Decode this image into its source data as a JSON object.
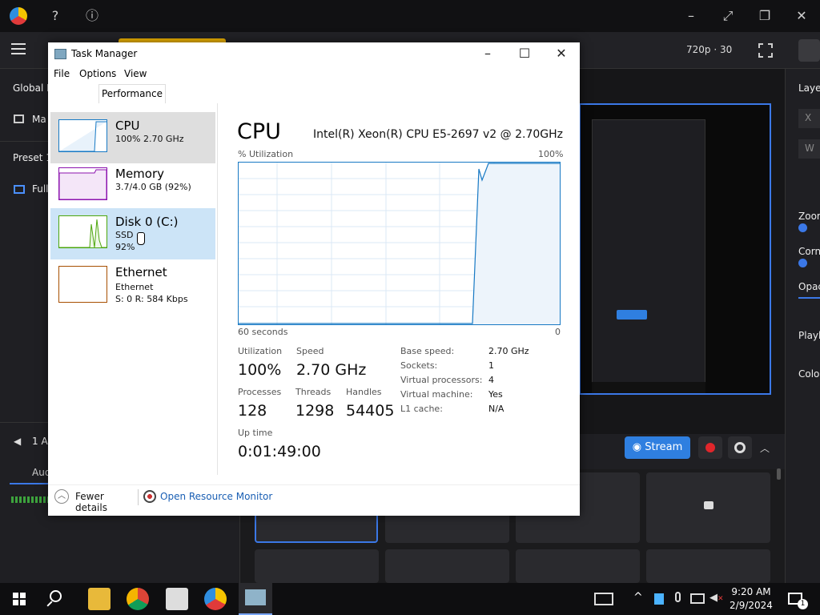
{
  "app": {
    "quality": "720p · 30",
    "left_items": [
      "Global F",
      "Ma",
      "Preset 1",
      "Full",
      "1 A",
      "Aud"
    ],
    "right_items": [
      "Laye",
      "X",
      "W",
      "Zoom",
      "Corne",
      "Opac",
      "Playl",
      "Colo"
    ],
    "stream_label": "Stream"
  },
  "task_manager": {
    "title": "Task Manager",
    "menu": [
      "File",
      "Options",
      "View"
    ],
    "tab": "Performance",
    "resources": [
      {
        "name": "CPU",
        "sub1": "100%  2.70 GHz",
        "sub2": "",
        "color": "#1779c4"
      },
      {
        "name": "Memory",
        "sub1": "3.7/4.0 GB (92%)",
        "sub2": "",
        "color": "#8b12ae"
      },
      {
        "name": "Disk 0 (C:)",
        "sub1": "SSD",
        "sub2": "92%",
        "color": "#4da60c"
      },
      {
        "name": "Ethernet",
        "sub1": "Ethernet",
        "sub2": "S: 0  R: 584 Kbps",
        "color": "#a74f01"
      }
    ],
    "cpu": {
      "heading": "CPU",
      "model": "Intel(R) Xeon(R) CPU E5-2697 v2 @ 2.70GHz",
      "util_label": "% Utilization",
      "max_label": "100%",
      "time_left": "60 seconds",
      "time_right": "0",
      "utilization_label": "Utilization",
      "utilization_value": "100%",
      "speed_label": "Speed",
      "speed_value": "2.70 GHz",
      "processes_label": "Processes",
      "processes_value": "128",
      "threads_label": "Threads",
      "threads_value": "1298",
      "handles_label": "Handles",
      "handles_value": "54405",
      "uptime_label": "Up time",
      "uptime_value": "0:01:49:00",
      "details": [
        {
          "k": "Base speed:",
          "v": "2.70 GHz"
        },
        {
          "k": "Sockets:",
          "v": "1"
        },
        {
          "k": "Virtual processors:",
          "v": "4"
        },
        {
          "k": "Virtual machine:",
          "v": "Yes"
        },
        {
          "k": "L1 cache:",
          "v": "N/A"
        }
      ]
    },
    "footer": {
      "fewer": "Fewer details",
      "resmon": "Open Resource Monitor"
    }
  },
  "taskbar": {
    "time": "9:20 AM",
    "date": "2/9/2024",
    "badge": "1"
  }
}
